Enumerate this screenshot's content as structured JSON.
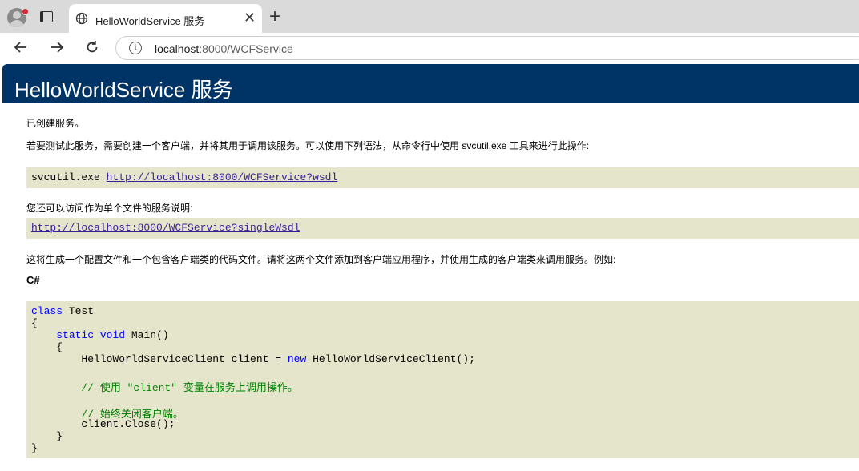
{
  "browser": {
    "tab_title": "HelloWorldService 服务",
    "url_host": "localhost",
    "url_rest": ":8000/WCFService",
    "icons": [
      "profile-icon",
      "tab-actions-icon",
      "globe-icon",
      "close-icon",
      "new-tab-icon",
      "back-icon",
      "forward-icon",
      "reload-icon",
      "info-icon"
    ]
  },
  "page": {
    "heading": "HelloWorldService 服务",
    "line_created": "已创建服务。",
    "line_test": "若要测试此服务，需要创建一个客户端，并将其用于调用该服务。可以使用下列语法，从命令行中使用 svcutil.exe 工具来进行此操作:",
    "svcutil_cmd": "svcutil.exe ",
    "svcutil_link": "http://localhost:8000/WCFService?wsdl",
    "line_single": "您还可以访问作为单个文件的服务说明:",
    "single_link": "http://localhost:8000/WCFService?singleWsdl",
    "line_generate": "这将生成一个配置文件和一个包含客户端类的代码文件。请将这两个文件添加到客户端应用程序，并使用生成的客户端类来调用服务。例如:",
    "lang_label": "C#"
  },
  "code": {
    "l1_kw": "class",
    "l1_rest": " Test",
    "l2": "{",
    "l3_indent": "    ",
    "l3_kw1": "static",
    "l3_sp": " ",
    "l3_kw2": "void",
    "l3_rest": " Main()",
    "l4": "    {",
    "l5_pre": "        HelloWorldServiceClient client = ",
    "l5_kw": "new",
    "l5_post": " HelloWorldServiceClient();",
    "l6_comment": "        // 使用 \"client\" 变量在服务上调用操作。",
    "l7_comment": "        // 始终关闭客户端。",
    "l8": "        client.Close();",
    "l9": "    }",
    "l10": "}"
  },
  "colors": {
    "heading_bg": "#003366",
    "code_bg": "#e5e5cc",
    "keyword": "#0000ff",
    "comment": "#008000",
    "link": "#3a1d9a"
  }
}
